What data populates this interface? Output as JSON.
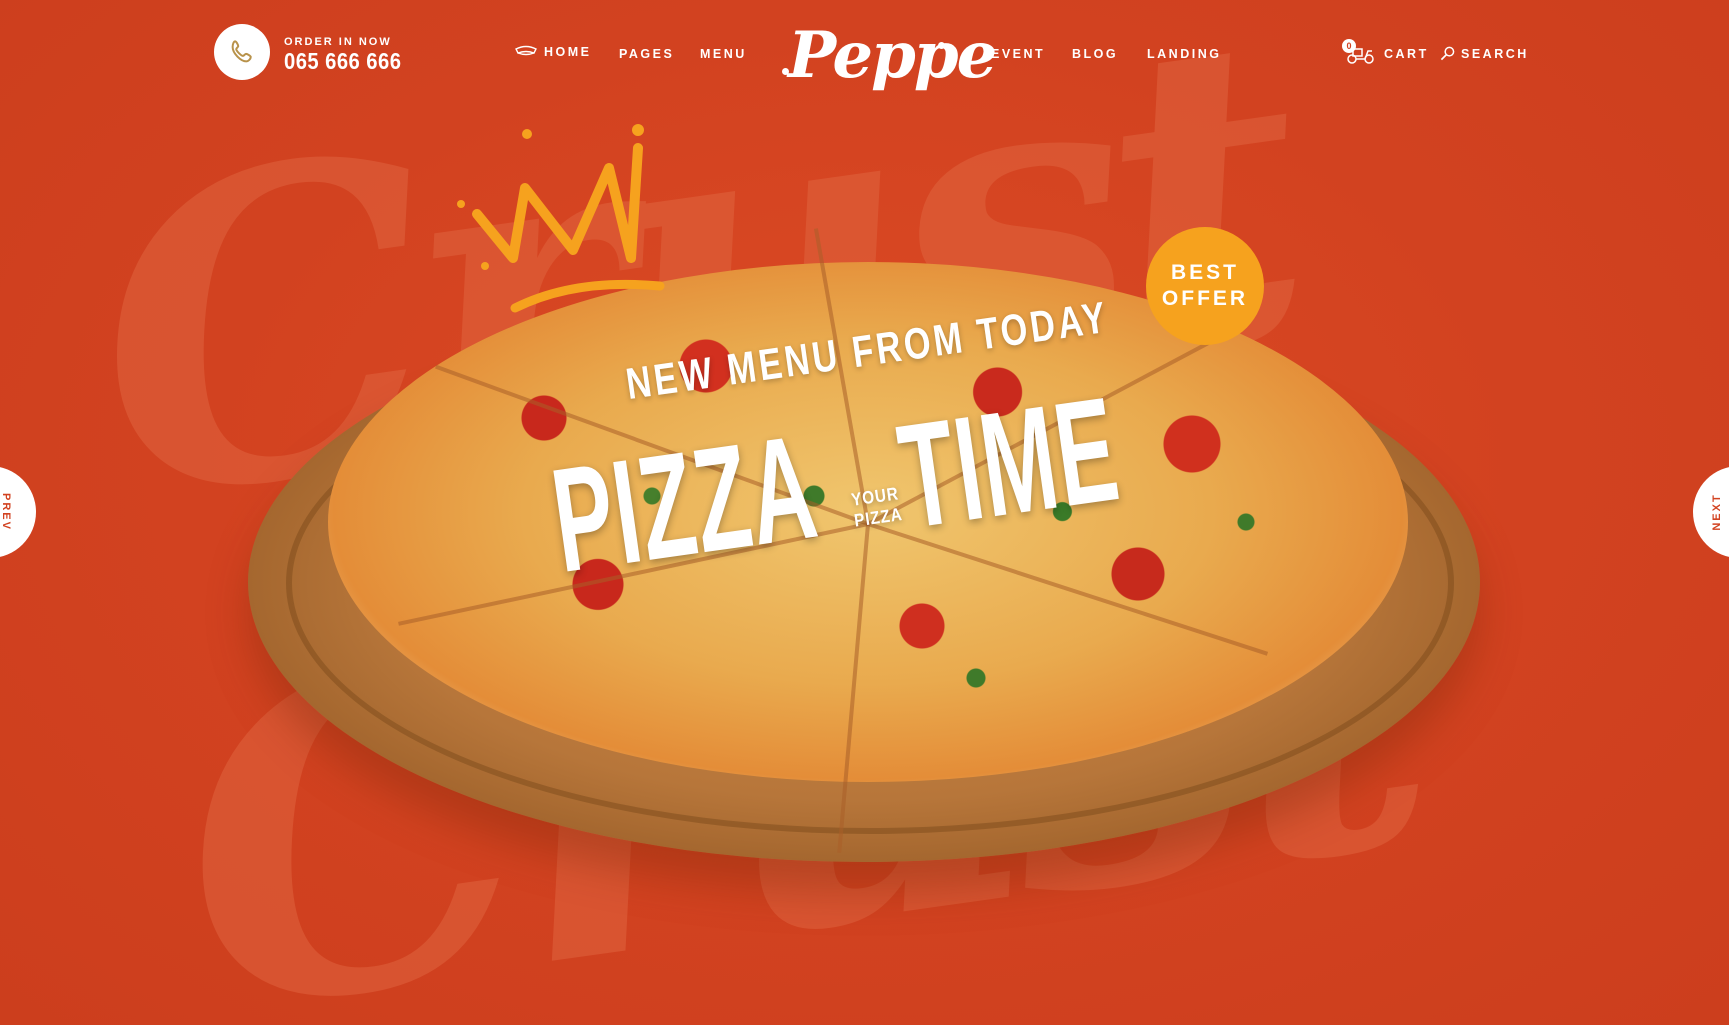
{
  "header": {
    "order_label": "ORDER IN NOW",
    "order_phone": "065 666 666",
    "phone_icon": "phone-icon",
    "nav": {
      "home": "HOME",
      "pages": "PAGES",
      "menu": "MENU",
      "event": "EVENT",
      "blog": "BLOG",
      "landing": "LANDING"
    },
    "logo": "Peppe",
    "cart_label": "CART",
    "cart_count": "0",
    "search_label": "SEARCH"
  },
  "background": {
    "script_top": "Crust",
    "script_bottom": "Crust"
  },
  "hero": {
    "subtitle": "NEW MENU FROM TODAY",
    "word_left": "PIZZA",
    "word_right": "TIME",
    "small_line1": "YOUR",
    "small_line2": "PIZZA",
    "badge_line1": "BEST",
    "badge_line2": "OFFER"
  },
  "slider": {
    "prev_label": "PREV",
    "next_label": "NEXT"
  },
  "colors": {
    "background": "#d24220",
    "badge": "#f6a21e",
    "crown": "#f6a21e",
    "text": "#ffffff"
  }
}
